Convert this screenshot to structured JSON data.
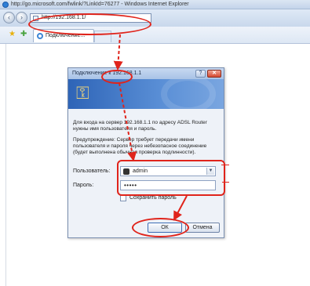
{
  "window": {
    "title": "http://go.microsoft.com/fwlink/?LinkId=76277 - Windows Internet Explorer"
  },
  "navbar": {
    "back_icon": "back-arrow-icon",
    "forward_icon": "forward-arrow-icon",
    "address": "http://192.168.1.1/"
  },
  "favorites": {
    "tab_label": "Подключение..."
  },
  "dialog": {
    "title": "Подключение к 192.168.1.1",
    "help_label": "?",
    "close_label": "✕",
    "message1": "Для входа на сервер 192.168.1.1 по адресу ADSL Router нужны имя пользователя и пароль.",
    "message2": "Предупреждение: Сервер требует передачи имени пользователя и пароля через небезопасное соединение (будет выполнена обычная проверка подлинности).",
    "username_label": "Пользователь:",
    "username_value": "admin",
    "password_label": "Пароль:",
    "password_value": "•••••",
    "remember_label": "Сохранить пароль",
    "ok_label": "ОК",
    "cancel_label": "Отмена"
  },
  "colors": {
    "annotation": "#e0241b",
    "banner": "#2e64b7"
  }
}
